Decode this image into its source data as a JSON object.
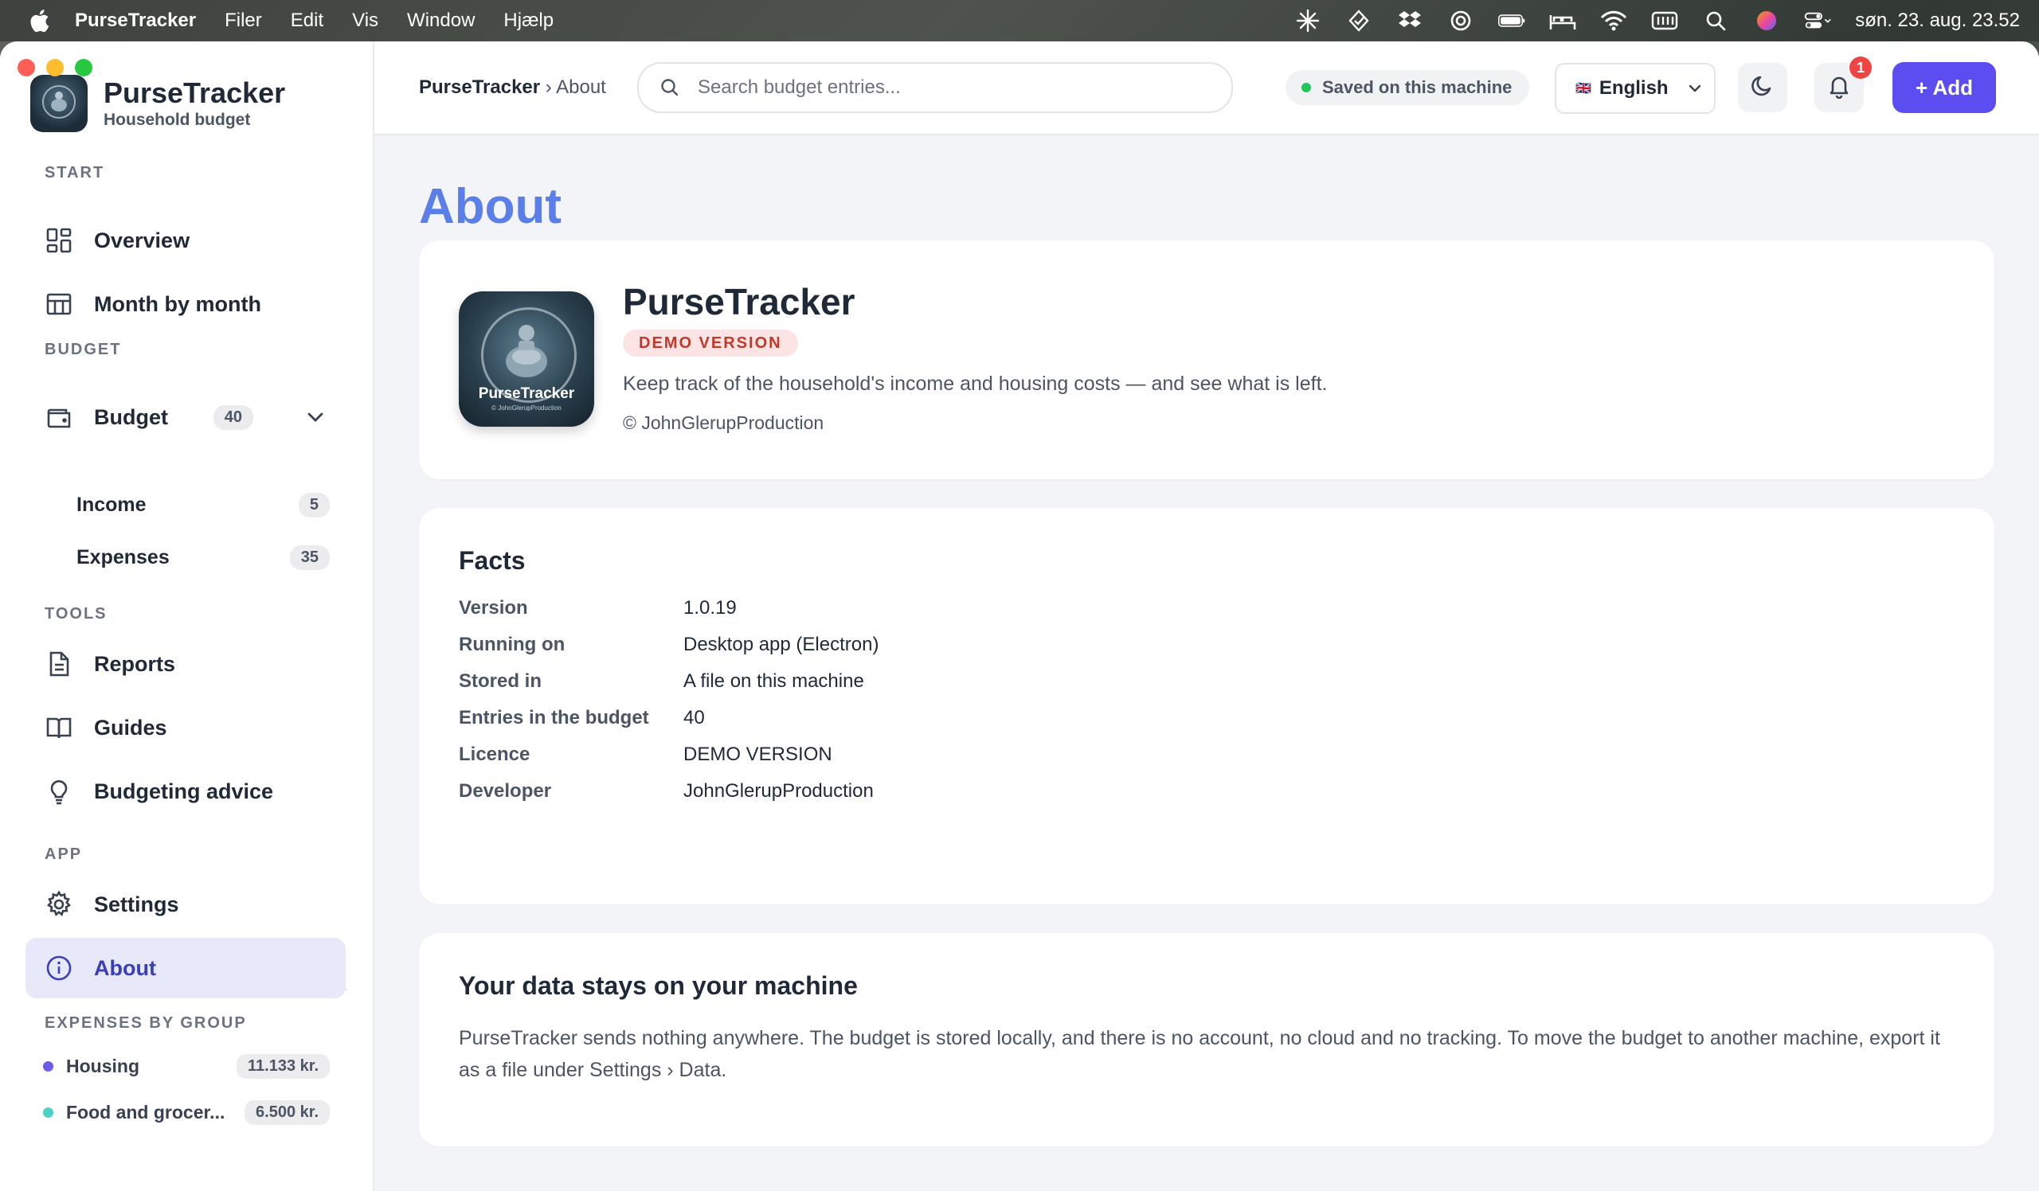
{
  "menubar": {
    "app_name": "PurseTracker",
    "menus": [
      "Filer",
      "Edit",
      "Vis",
      "Window",
      "Hjælp"
    ],
    "clock": "søn. 23. aug. 23.52"
  },
  "sidebar": {
    "brand_name": "PurseTracker",
    "brand_sub": "Household budget",
    "sections": {
      "start": "START",
      "budget": "BUDGET",
      "tools": "TOOLS",
      "app": "APP",
      "groups": "EXPENSES BY GROUP"
    },
    "items": {
      "overview": "Overview",
      "month": "Month by month",
      "budget": "Budget",
      "budget_count": "40",
      "income": "Income",
      "income_count": "5",
      "expenses": "Expenses",
      "expenses_count": "35",
      "reports": "Reports",
      "guides": "Guides",
      "advice": "Budgeting advice",
      "settings": "Settings",
      "about": "About"
    },
    "groups": [
      {
        "name": "Housing",
        "amount": "11.133 kr.",
        "color": "#6c5ce7"
      },
      {
        "name": "Food and grocer...",
        "amount": "6.500 kr.",
        "color": "#4fd1c5"
      }
    ]
  },
  "header": {
    "crumb_root": "PurseTracker",
    "crumb_sep": "›",
    "crumb_current": "About",
    "search_placeholder": "Search budget entries...",
    "saved_status": "Saved on this machine",
    "language": "English",
    "flag": "🇬🇧",
    "notifications": "1",
    "add_label": "+ Add"
  },
  "main": {
    "title": "About",
    "app_card": {
      "name": "PurseTracker",
      "badge": "DEMO VERSION",
      "description": "Keep track of the household's income and housing costs — and see what is left.",
      "copyright": "© JohnGlerupProduction",
      "logo_text": "PurseTracker",
      "logo_sub": "© JohnGlerupProduction"
    },
    "facts": {
      "title": "Facts",
      "rows": [
        {
          "key": "Version",
          "value": "1.0.19"
        },
        {
          "key": "Running on",
          "value": "Desktop app (Electron)"
        },
        {
          "key": "Stored in",
          "value": "A file on this machine"
        },
        {
          "key": "Entries in the budget",
          "value": "40"
        },
        {
          "key": "Licence",
          "value": "DEMO VERSION"
        },
        {
          "key": "Developer",
          "value": "JohnGlerupProduction"
        }
      ]
    },
    "privacy": {
      "title": "Your data stays on your machine",
      "text": "PurseTracker sends nothing anywhere. The budget is stored locally, and there is no account, no cloud and no tracking. To move the budget to another machine, export it as a file under Settings › Data."
    }
  },
  "colors": {
    "accent": "#5b4df0",
    "title_blue": "#5b7fe8",
    "active_bg": "#e7e9fb",
    "badge_red": "#c0392b"
  }
}
